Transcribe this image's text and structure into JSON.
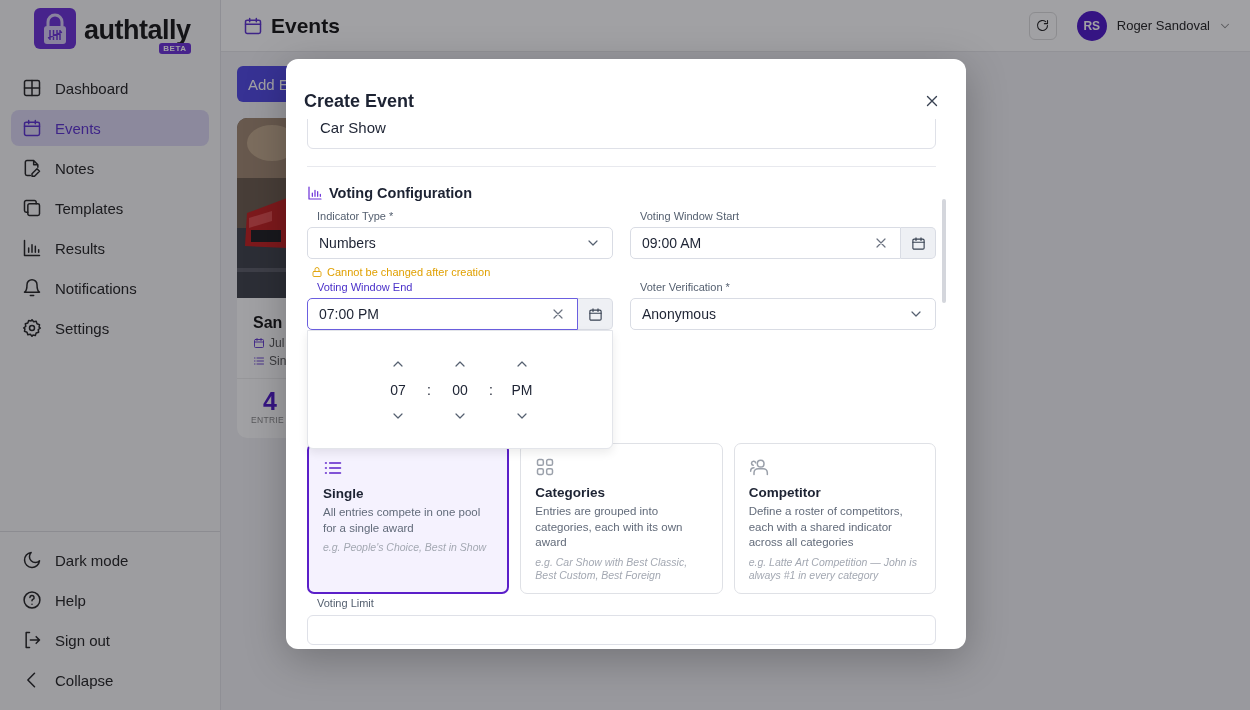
{
  "sidebar": {
    "logo": {
      "name": "authtally",
      "badge": "BETA"
    },
    "items": [
      {
        "kind": "dashboard",
        "label": "Dashboard",
        "selected": false
      },
      {
        "kind": "calendar",
        "label": "Events",
        "selected": true
      },
      {
        "kind": "note",
        "label": "Notes",
        "selected": false
      },
      {
        "kind": "copy",
        "label": "Templates",
        "selected": false
      },
      {
        "kind": "chart",
        "label": "Results",
        "selected": false
      },
      {
        "kind": "bell",
        "label": "Notifications",
        "selected": false
      },
      {
        "kind": "gear",
        "label": "Settings",
        "selected": false
      }
    ],
    "footer_items": [
      {
        "kind": "moon",
        "label": "Dark mode"
      },
      {
        "kind": "help",
        "label": "Help"
      },
      {
        "kind": "signout",
        "label": "Sign out"
      },
      {
        "kind": "chevron",
        "label": "Collapse"
      }
    ]
  },
  "header": {
    "title": "Events",
    "user": {
      "initials": "RS",
      "name": "Roger Sandoval"
    }
  },
  "background": {
    "add_button": "Add E",
    "card": {
      "kind": "picture",
      "title": "San",
      "date": "Jul",
      "type": "Sin",
      "count": "4",
      "count_label": "ENTRIE"
    }
  },
  "modal": {
    "title": "Create Event",
    "name_value": "Car Show",
    "section_title": "Voting Configuration",
    "fields": [
      {
        "kind": "select",
        "label": "Indicator Type *",
        "value": "Numbers",
        "hint": "Cannot be changed after creation",
        "focused": false
      },
      {
        "kind": "time",
        "label": "Voting Window Start",
        "value": "09:00 AM",
        "focused": false
      },
      {
        "kind": "time",
        "label": "Voting Window End",
        "value": "07:00 PM",
        "focused": true
      },
      {
        "kind": "select",
        "label": "Voter Verification *",
        "value": "Anonymous",
        "focused": false
      }
    ],
    "time_picker": {
      "columns": [
        "07",
        "00",
        "PM"
      ],
      "separators": [
        ":",
        ":"
      ]
    },
    "type_options": [
      {
        "kind": "list",
        "title": "Single",
        "description": "All entries compete in one pool for a single award",
        "example": "e.g. People's Choice, Best in Show",
        "selected": true
      },
      {
        "kind": "grid",
        "title": "Categories",
        "description": "Entries are grouped into categories, each with its own award",
        "example": "e.g. Car Show with Best Classic, Best Custom, Best Foreign",
        "selected": false
      },
      {
        "kind": "people",
        "title": "Competitor",
        "description": "Define a roster of competitors, each with a shared indicator across all categories",
        "example": "e.g. Latte Art Competition — John is always #1 in every category",
        "selected": false
      }
    ],
    "voting_limit_label": "Voting Limit"
  }
}
